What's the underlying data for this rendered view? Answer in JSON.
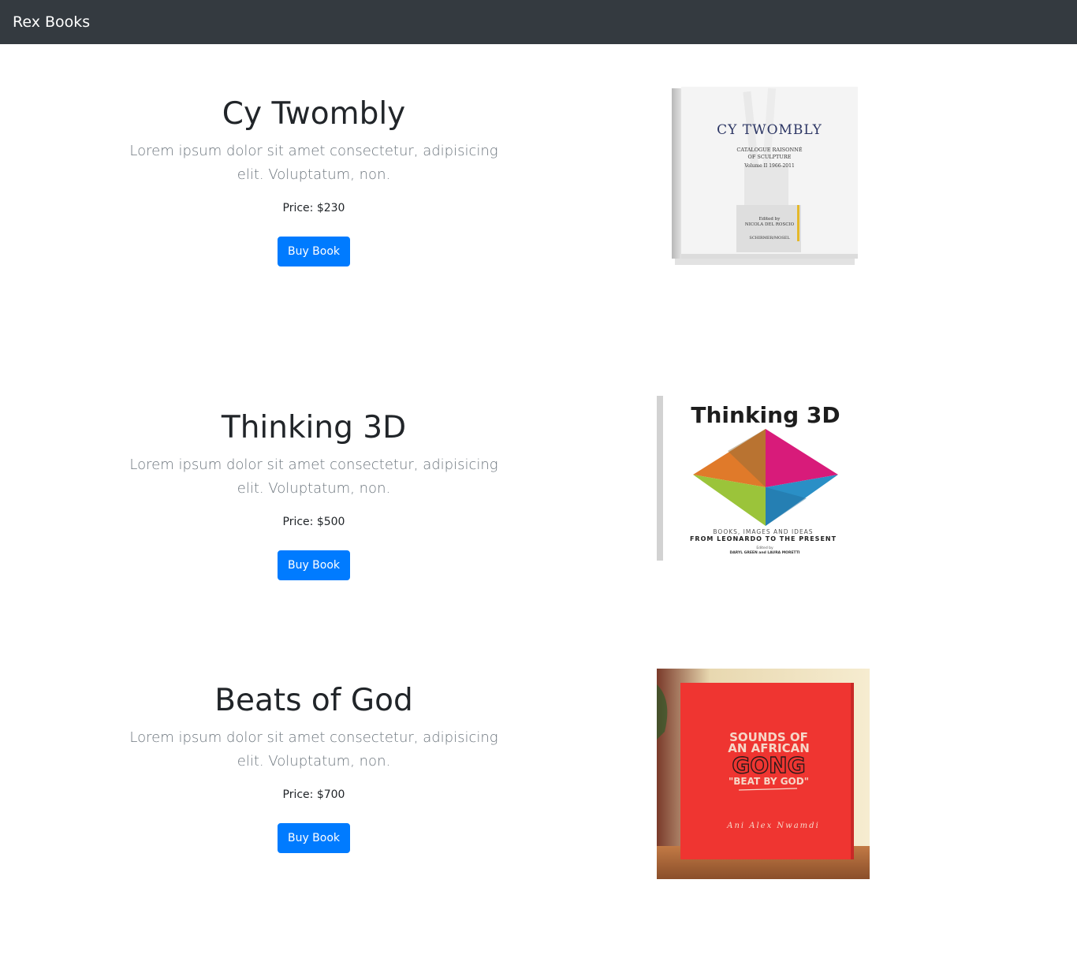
{
  "navbar": {
    "brand": "Rex Books"
  },
  "books": [
    {
      "title": "Cy Twombly",
      "description": "Lorem ipsum dolor sit amet consectetur, adipisicing elit. Voluptatum, non.",
      "price": "Price: $230",
      "button": "Buy Book",
      "cover": {
        "title": "CY TWOMBLY",
        "line1": "CATALOGUE RAISONNÉ",
        "line2": "OF SCULPTURE",
        "line3": "Volume II  1966-2011",
        "editor_label": "Edited by",
        "editor": "NICOLA DEL ROSCIO",
        "publisher": "SCHIRMER/MOSEL"
      }
    },
    {
      "title": "Thinking 3D",
      "description": "Lorem ipsum dolor sit amet consectetur, adipisicing elit. Voluptatum, non.",
      "price": "Price: $500",
      "button": "Buy Book",
      "cover": {
        "title": "Thinking 3D",
        "subtitle1": "BOOKS, IMAGES AND IDEAS",
        "subtitle2": "FROM LEONARDO TO THE PRESENT",
        "editor_label": "Edited by",
        "editors": "DARYL GREEN and LAURA MORETTI"
      }
    },
    {
      "title": "Beats of God",
      "description": "Lorem ipsum dolor sit amet consectetur, adipisicing elit. Voluptatum, non.",
      "price": "Price: $700",
      "button": "Buy Book",
      "cover": {
        "line1": "SOUNDS OF",
        "line2": "AN AFRICAN",
        "line3": "GONG",
        "line4": "\"BEAT BY GOD\"",
        "author": "Ani Alex Nwamdi"
      }
    }
  ]
}
